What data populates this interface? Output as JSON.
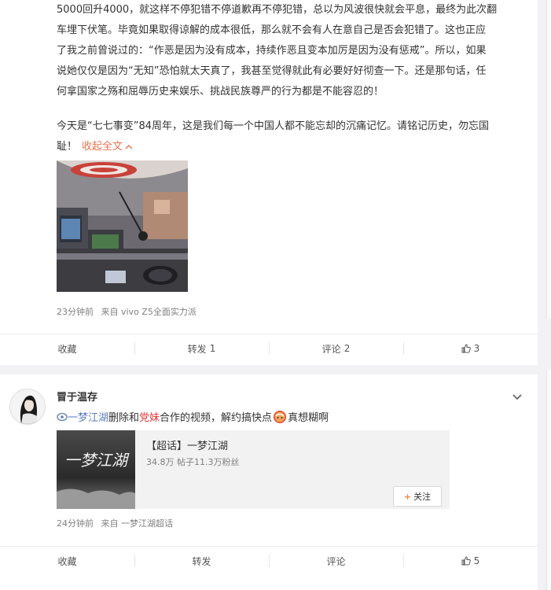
{
  "post1": {
    "p1_l1": "5000回升4000，就这样不停犯错不停道歉再不停犯错，总以为风波很快就会平息，最终为此次翻",
    "p1_l2": "车埋下伏笔。毕竟如果取得谅解的成本很低，那么就不会有人在意自己是否会犯错了。这也正应",
    "p1_l3": "了我之前曾说过的：“作恶是因为没有成本，持续作恶且变本加厉是因为没有惩戒”。所以，如果",
    "p1_l4": "说她仅仅是因为“无知”恐怕就太天真了，我甚至觉得就此有必要好好彻查一下。还是那句话，任",
    "p1_l5": "何拿国家之殇和屈辱历史来娱乐、挑战民族尊严的行为都是不能容忍的！",
    "p2_l1": "今天是“七七事变”84周年，这是我们每一个中国人都不能忘却的沉痛记忆。请铭记历史，勿忘国",
    "p2_l2": "耻！",
    "collapse": "收起全文",
    "time": "23分钟前",
    "source": "来自 vivo Z5全面实力派",
    "actions": {
      "fav": "收藏",
      "repost": "转发",
      "repost_count": "1",
      "comment": "评论",
      "comment_count": "2",
      "like_count": "3"
    }
  },
  "post2": {
    "author": "冒于温存",
    "topic_link": "一梦江湖",
    "text_a": "删除和",
    "party_link": "党妹",
    "text_b": "合作的视频，解约搞快点",
    "text_c": "真想糊啊",
    "card_title": "【超话】一梦江湖",
    "card_stats": "34.8万 帖子11.3万粉丝",
    "card_img_text": "一梦江湖",
    "follow": "关注",
    "time": "24分钟前",
    "source": "来自 一梦江湖超话",
    "actions": {
      "fav": "收藏",
      "repost": "转发",
      "comment": "评论",
      "like_count": "5"
    }
  },
  "colors": {
    "accent": "#eb7350",
    "link_blue": "#5d7dbd",
    "party_red": "#e0393e"
  }
}
